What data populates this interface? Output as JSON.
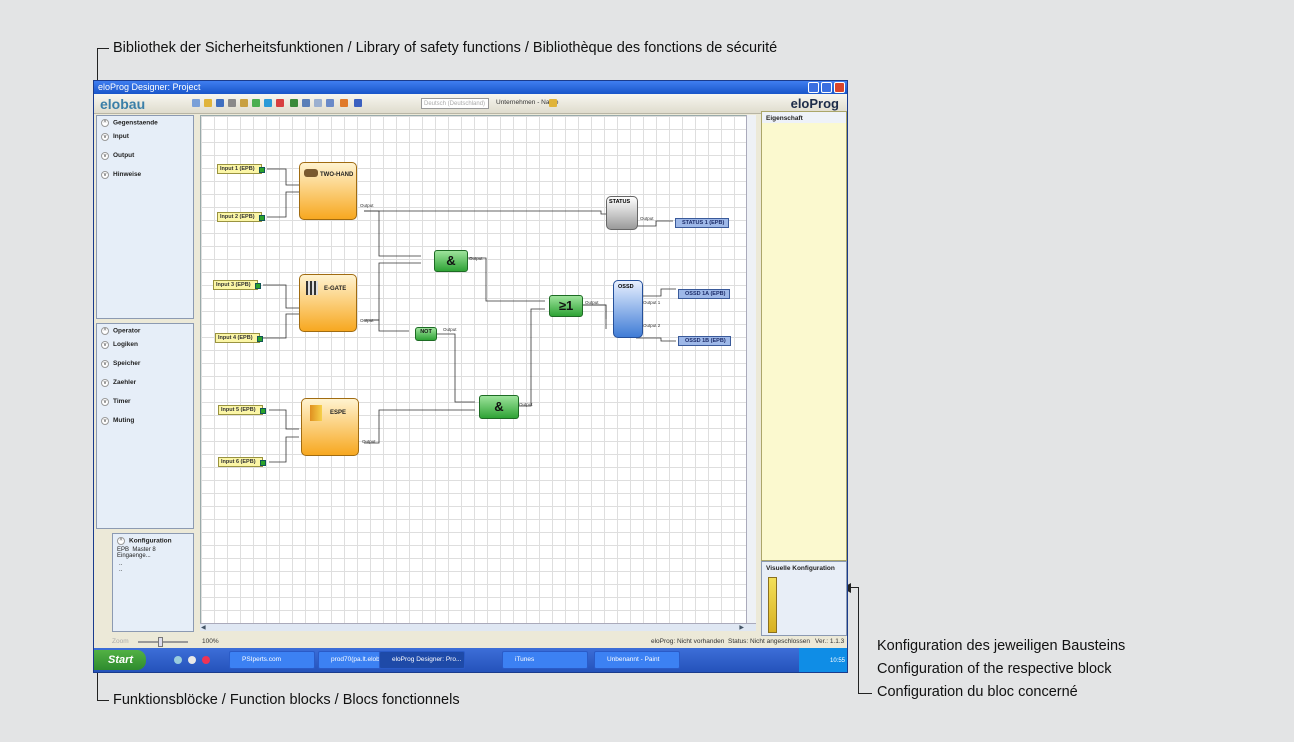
{
  "callouts": {
    "library": "Bibliothek der Sicherheitsfunktionen / Library of safety functions / Bibliothèque des fonctions de sécurité",
    "function_blocks": "Funktionsblöcke / Function blocks / Blocs fonctionnels",
    "config_de": "Konfiguration des jeweiligen Bausteins",
    "config_en": "Configuration of the respective block",
    "config_fr": "Configuration du bloc concerné"
  },
  "window": {
    "title": "eloProg Designer: Project",
    "brand_left": "elobau",
    "brand_right": "eloProg",
    "language_select": "Deutsch (Deutschland)",
    "company_field": "Unternehmen - Name"
  },
  "library_panel": {
    "title": "Gegenstaende",
    "items": [
      "Input",
      "Output",
      "Hinweise"
    ]
  },
  "operator_panel": {
    "title": "Operator",
    "items": [
      "Logiken",
      "Speicher",
      "Zaehler",
      "Timer",
      "Muting"
    ]
  },
  "config_panel": {
    "title": "Konfiguration",
    "row1_key": "EPB",
    "row1_val": "Master 8 Eingaenge...",
    "row2": "..",
    "row3": ".."
  },
  "property_panel": {
    "title": "Eigenschaft"
  },
  "visual_panel": {
    "title": "Visuelle Konfiguration"
  },
  "diagram": {
    "inputs": [
      "Input 1 (EPB)",
      "Input 2 (EPB)",
      "Input 3 (EPB)",
      "Input 4 (EPB)",
      "Input 5 (EPB)",
      "Input 6 (EPB)"
    ],
    "blocks": {
      "two_hand": "TWO-HAND",
      "e_gate": "E-GATE",
      "espe": "ESPE",
      "status": "STATUS",
      "ossd": "OSSD",
      "not": "NOT",
      "and": "&",
      "or": "≥1"
    },
    "outputs": [
      "STATUS 1 (EPB)",
      "OSSD 1A (EPB)",
      "OSSD 1B (EPB)"
    ],
    "port_output": "Output",
    "port_output1": "Output 1",
    "port_output2": "Output 2"
  },
  "statusbar": {
    "zoom_label": "Zoom",
    "zoom_value": "100%",
    "eloprog_state": "eloProg: Nicht vorhanden",
    "status": "Status: Nicht angeschlossen",
    "version": "Ver.: 1.1.3"
  },
  "taskbar": {
    "start": "Start",
    "tasks": [
      "PSIperts.com",
      "prod70(pa.lt.elobau...",
      "eloProg Designer: Pro...",
      "iTunes",
      "Unbenannt - Paint"
    ],
    "clock": "10:55"
  }
}
